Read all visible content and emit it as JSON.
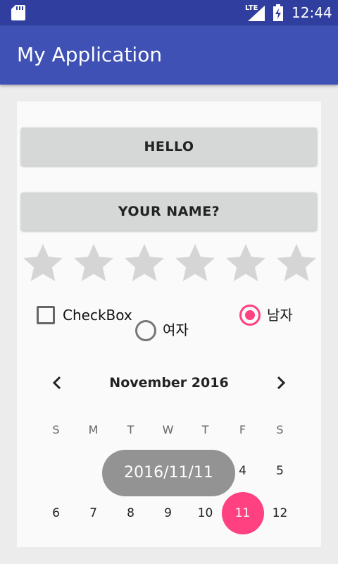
{
  "status_bar": {
    "network": "LTE",
    "time": "12:44",
    "icons": [
      "sd-card-icon",
      "signal-icon",
      "battery-charging-icon"
    ]
  },
  "app_bar": {
    "title": "My Application"
  },
  "buttons": {
    "hello": "HELLO",
    "your_name": "YOUR NAME?"
  },
  "rating": {
    "max_stars": 6,
    "value": 0
  },
  "checkbox": {
    "label": "CheckBox",
    "checked": false
  },
  "radios": [
    {
      "label": "여자",
      "checked": false
    },
    {
      "label": "남자",
      "checked": true
    }
  ],
  "calendar": {
    "month_title": "November 2016",
    "weekdays": [
      "S",
      "M",
      "T",
      "W",
      "T",
      "F",
      "S"
    ],
    "visible_days": [
      "4",
      "5",
      "6",
      "7",
      "8",
      "9",
      "10",
      "11",
      "12"
    ],
    "selected_day": "11",
    "accent_color": "#FF4081"
  },
  "toast": {
    "text": "2016/11/11"
  },
  "colors": {
    "primary": "#3F51B5",
    "primary_dark": "#303F9F",
    "accent": "#FF4081"
  }
}
